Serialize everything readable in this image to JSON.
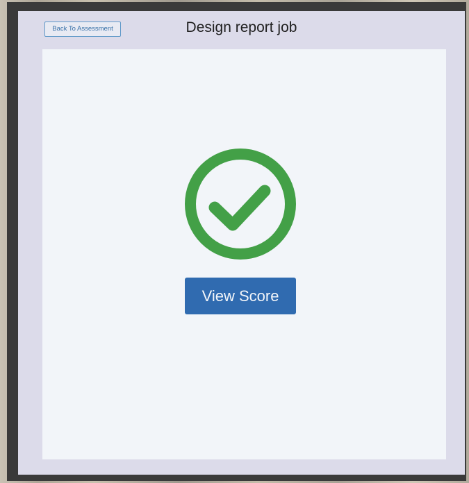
{
  "dialog": {
    "title": "Design report job",
    "back_button_label": "Back To Assessment"
  },
  "result": {
    "status_icon": "check-circle-icon",
    "action_label": "View Score"
  },
  "colors": {
    "success": "#43a047",
    "primary_button": "#306bb0",
    "dialog_background": "#dcdbea",
    "panel_background": "#f2f5f9"
  }
}
